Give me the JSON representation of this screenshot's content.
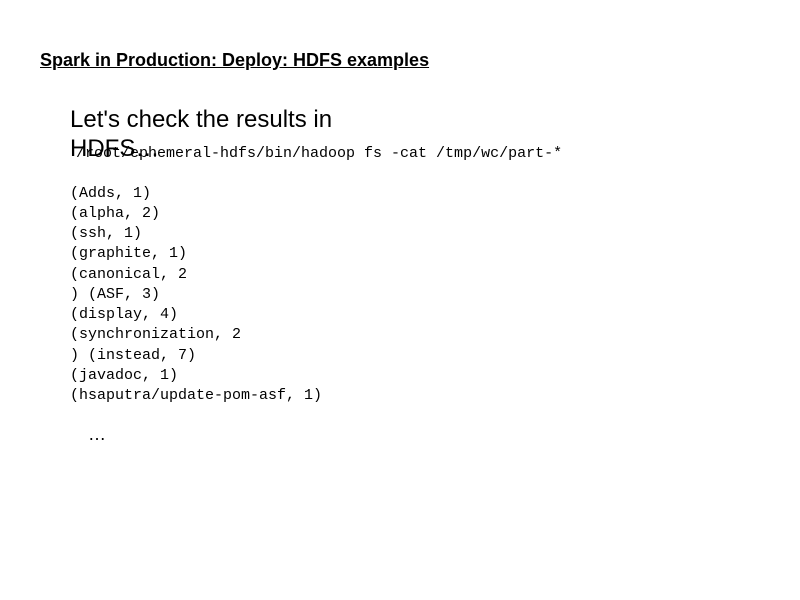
{
  "title": "Spark in Production: Deploy: HDFS examples",
  "subtitle_line1": "Let's check the results in",
  "subtitle_line2": "HDFS…",
  "command": "/root/ephemeral-hdfs/bin/hadoop fs -cat /tmp/wc/part-*",
  "output_lines": [
    "(Adds, 1)",
    "(alpha, 2)",
    "(ssh, 1)",
    "(graphite, 1)",
    "(canonical, 2",
    ")  (ASF, 3)",
    "(display, 4)",
    "(synchronization, 2",
    ")  (instead, 7)",
    "(javadoc, 1)",
    "(hsaputra/update-pom-asf, 1)"
  ],
  "trailing": "…"
}
